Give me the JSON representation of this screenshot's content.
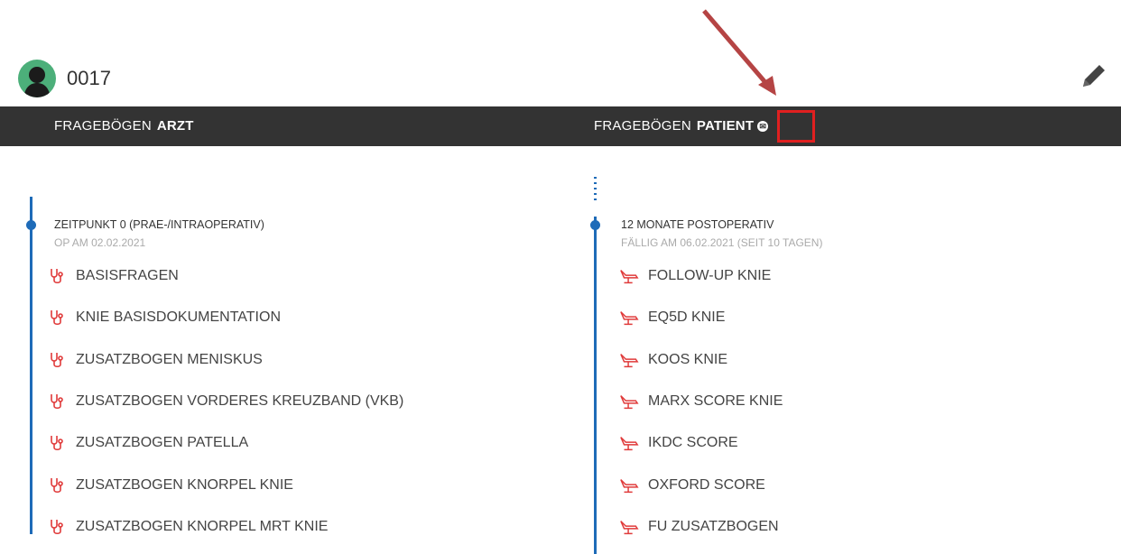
{
  "header": {
    "patient_id": "0017"
  },
  "bar": {
    "left_prefix": "FRAGEBÖGEN",
    "left_strong": "ARZT",
    "right_prefix": "FRAGEBÖGEN",
    "right_strong": "PATIENT",
    "mail_glyph": "✉"
  },
  "left_section": {
    "title": "ZEITPUNKT 0 (PRAE-/INTRAOPERATIV)",
    "subtitle": "OP AM 02.02.2021",
    "icon": "stethoscope-icon",
    "items": [
      "BASISFRAGEN",
      "KNIE BASISDOKUMENTATION",
      "ZUSATZBOGEN MENISKUS",
      "ZUSATZBOGEN VORDERES KREUZBAND (VKB)",
      "ZUSATZBOGEN PATELLA",
      "ZUSATZBOGEN KNORPEL KNIE",
      "ZUSATZBOGEN KNORPEL MRT KNIE"
    ]
  },
  "right_section": {
    "title": "12 MONATE POSTOPERATIV",
    "subtitle": "FÄLLIG AM 06.02.2021 (SEIT 10 TAGEN)",
    "icon": "patient-chair-icon",
    "items": [
      "FOLLOW-UP KNIE",
      "EQ5D KNIE",
      "KOOS KNIE",
      "MARX SCORE KNIE",
      "IKDC SCORE",
      "OXFORD SCORE",
      "FU ZUSATZBOGEN"
    ]
  },
  "colors": {
    "accent": "#1e6bb8",
    "icon_red": "#e03a3a",
    "bar_bg": "#333333",
    "highlight": "#e02020",
    "arrow": "#b54444"
  }
}
